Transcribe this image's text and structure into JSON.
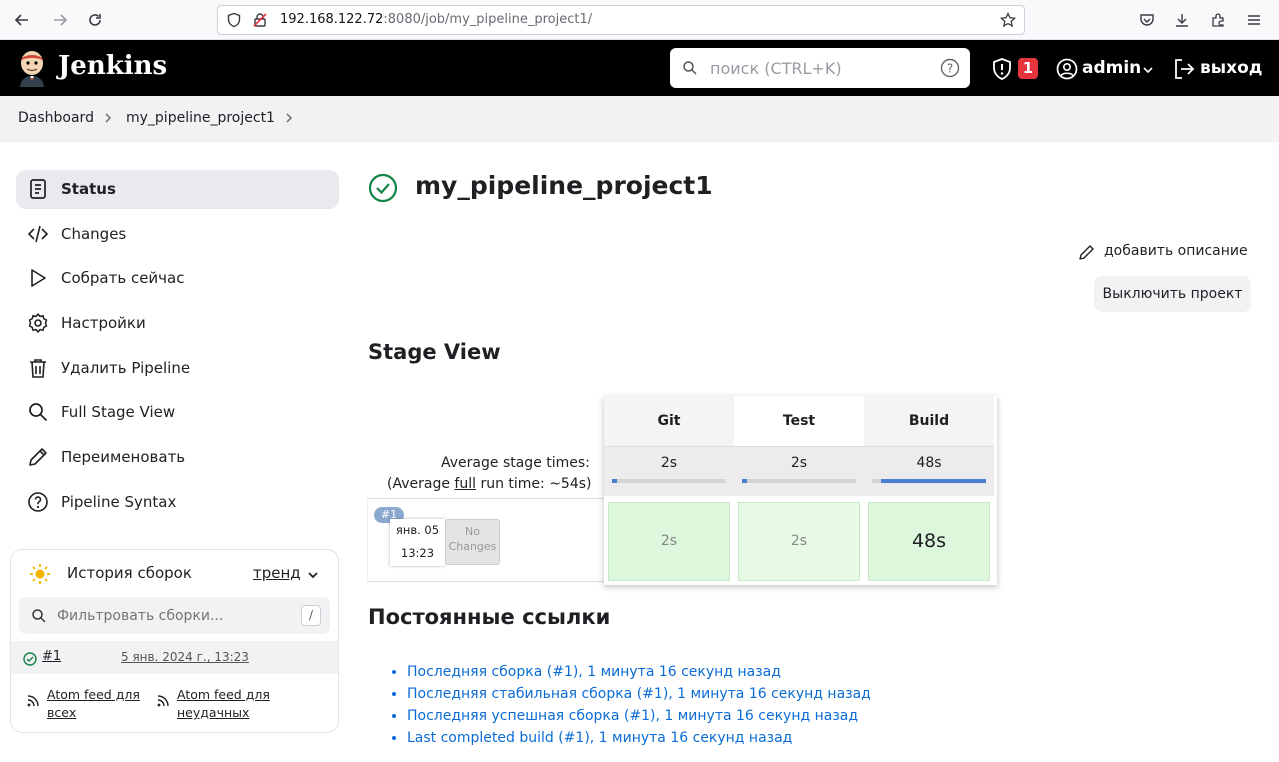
{
  "browser": {
    "url_host": "192.168.122.72",
    "url_rest": ":8080/job/my_pipeline_project1/"
  },
  "header": {
    "logo_text": "Jenkins",
    "search_placeholder": "поиск (CTRL+K)",
    "alert_count": "1",
    "user": "admin",
    "logout": "выход"
  },
  "breadcrumbs": [
    "Dashboard",
    "my_pipeline_project1"
  ],
  "sidebar": {
    "items": [
      {
        "label": "Status",
        "icon": "document-icon"
      },
      {
        "label": "Changes",
        "icon": "code-icon"
      },
      {
        "label": "Собрать сейчас",
        "icon": "play-icon"
      },
      {
        "label": "Настройки",
        "icon": "gear-icon"
      },
      {
        "label": "Удалить Pipeline",
        "icon": "trash-icon"
      },
      {
        "label": "Full Stage View",
        "icon": "search-icon"
      },
      {
        "label": "Переименовать",
        "icon": "pencil-icon"
      },
      {
        "label": "Pipeline Syntax",
        "icon": "help-icon"
      }
    ]
  },
  "history": {
    "title": "История сборок",
    "trend": "тренд",
    "filter_placeholder": "Фильтровать сборки...",
    "filter_shortcut": "/",
    "build_id": "#1",
    "build_date": "5 янв. 2024 г., 13:23",
    "atom_all": "Atom feed для всех",
    "atom_failed": "Atom feed для неудачных"
  },
  "main": {
    "title": "my_pipeline_project1",
    "add_description": "добавить описание",
    "disable_project": "Выключить проект",
    "stage_view_title": "Stage View",
    "avg_stage_times": "Average stage times:",
    "avg_full_prefix": "(Average ",
    "avg_full_word": "full",
    "avg_full_suffix": " run time: ~54s)",
    "build_badge": "#1",
    "build_date": "янв. 05",
    "build_time": "13:23",
    "no_changes": "No Changes",
    "stages": [
      {
        "name": "Git",
        "avg": "2s",
        "run": "2s",
        "progress": 0.04
      },
      {
        "name": "Test",
        "avg": "2s",
        "run": "2s",
        "progress": 0.04
      },
      {
        "name": "Build",
        "avg": "48s",
        "run": "48s",
        "progress": 0.92
      }
    ],
    "permalinks_title": "Постоянные ссылки",
    "permalinks": [
      "Последняя сборка (#1), 1 минута 16 секунд назад",
      "Последняя стабильная сборка (#1), 1 минута 16 секунд назад",
      "Последняя успешная сборка (#1), 1 минута 16 секунд назад",
      "Last completed build (#1), 1 минута 16 секунд назад"
    ]
  },
  "colors": {
    "success": "#138347",
    "stage_success": "#dcf7dc",
    "progress_blue": "#4a7fd4",
    "link": "#0b6cd6",
    "alert": "#e6343f"
  }
}
